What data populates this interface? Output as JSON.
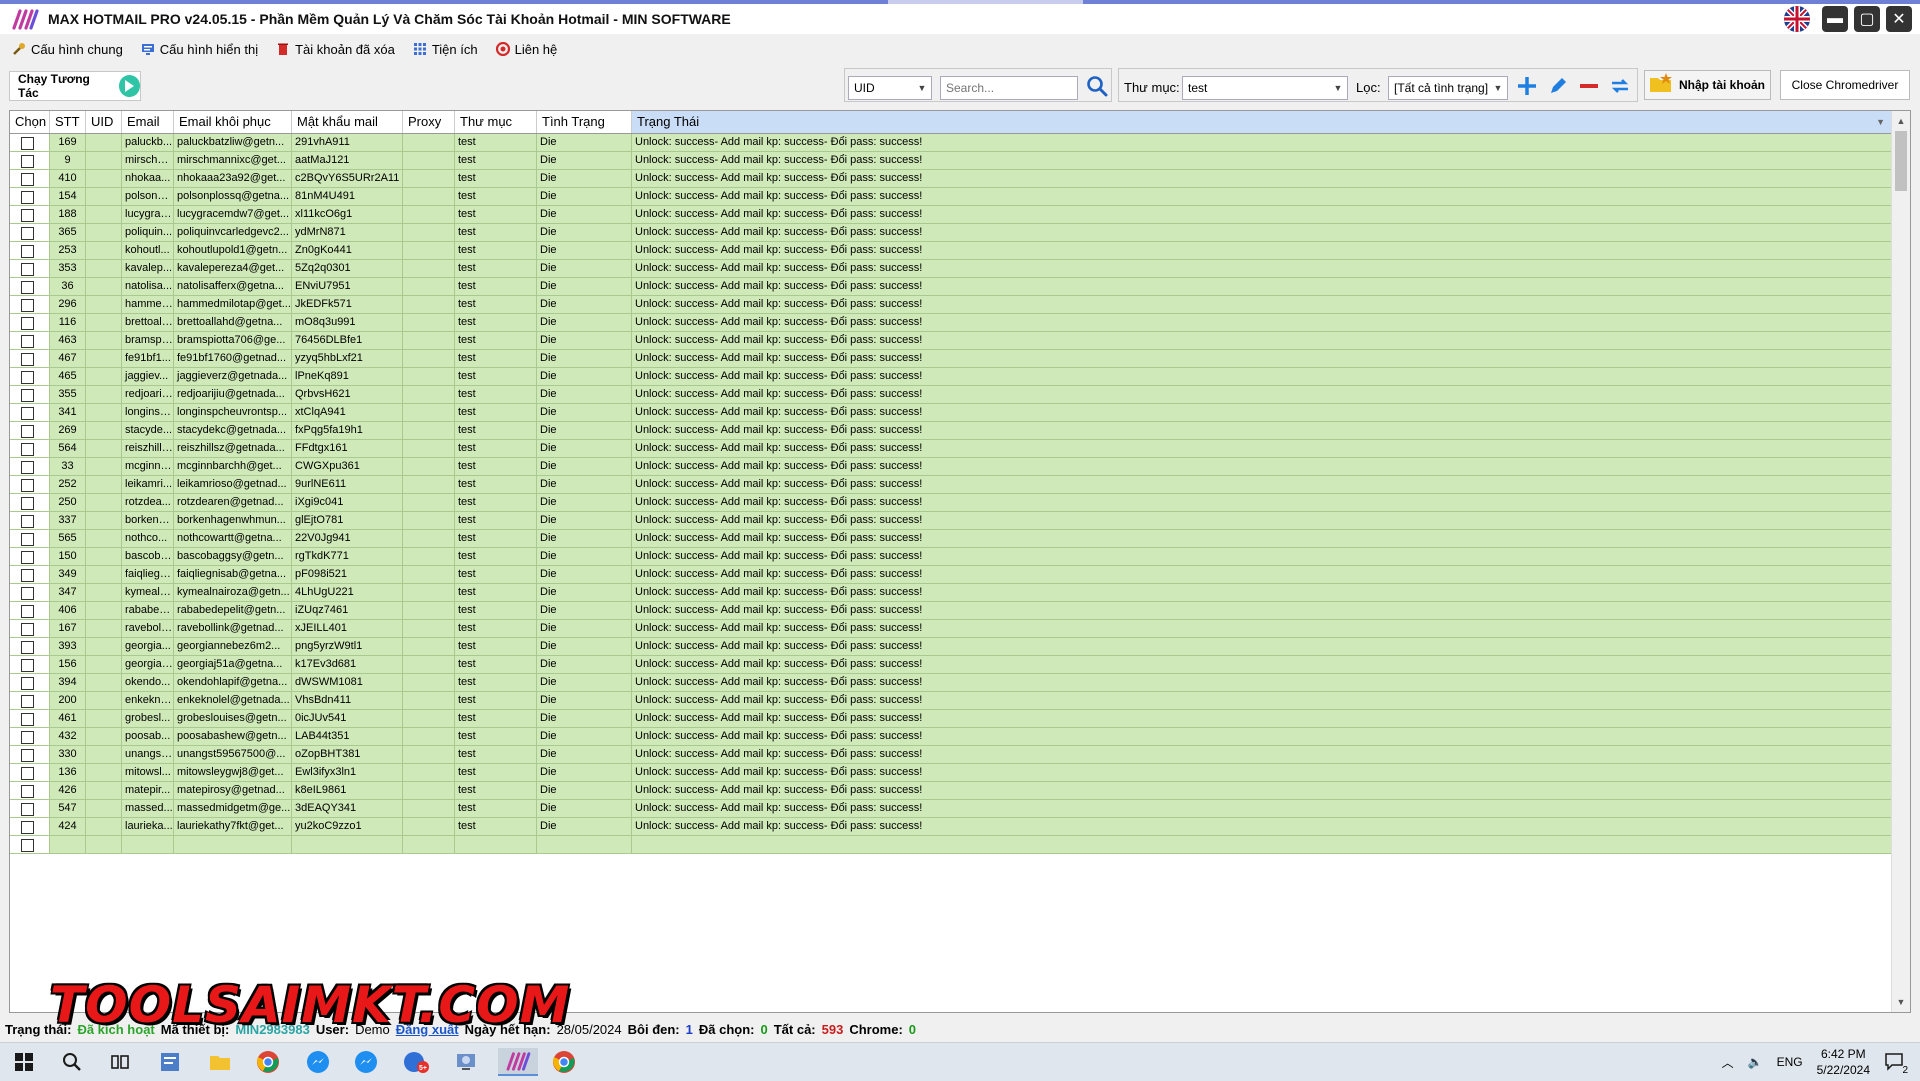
{
  "window": {
    "title": "MAX HOTMAIL PRO v24.05.15 - Phần Mềm Quản Lý Và Chăm Sóc Tài Khoản Hotmail - MIN SOFTWARE",
    "min_glyph": "▬",
    "max_glyph": "▢",
    "close_glyph": "✕"
  },
  "menu": {
    "items": [
      {
        "label": "Cấu hình chung",
        "icon": "wrench-icon",
        "color": "#c08a1e"
      },
      {
        "label": "Cấu hình hiển thị",
        "icon": "display-settings-icon",
        "color": "#3b6fd4"
      },
      {
        "label": "Tài khoản đã xóa",
        "icon": "trash-icon",
        "color": "#d42a2a"
      },
      {
        "label": "Tiện ích",
        "icon": "grid-apps-icon",
        "color": "#3b6fd4"
      },
      {
        "label": "Liên hệ",
        "icon": "contact-icon",
        "color": "#d42a2a"
      }
    ]
  },
  "toolbar": {
    "run_label": "Chạy Tương Tác",
    "search_field": "UID",
    "search_placeholder": "Search...",
    "folder_label": "Thư mục:",
    "folder_value": "test",
    "filter_label": "Lọc:",
    "filter_value": "[Tất cả tình trạng]",
    "import_label": "Nhập tài khoản",
    "close_chrome_label": "Close Chromedriver"
  },
  "grid": {
    "columns": [
      "Chọn",
      "STT",
      "UID",
      "Email",
      "Email khôi phục",
      "Mật khẩu mail",
      "Proxy",
      "Thư mục",
      "Tình Trạng",
      "Trạng Thái"
    ],
    "status_text": "Unlock: success- Add mail kp: success- Đổi pass: success!",
    "folder": "test",
    "state": "Die",
    "rows": [
      [
        "169",
        "paluckb...",
        "paluckbatzliw@getn...",
        "291vhA911"
      ],
      [
        "9",
        "mirschm...",
        "mirschmannixc@get...",
        "aatMaJ121"
      ],
      [
        "410",
        "nhokaa...",
        "nhokaaa23a92@get...",
        "c2BQvY6S5URr2A11"
      ],
      [
        "154",
        "polsonpl...",
        "polsonplossq@getna...",
        "81nM4U491"
      ],
      [
        "188",
        "lucygrac...",
        "lucygracemdw7@get...",
        "xl11kcO6g1"
      ],
      [
        "365",
        "poliquin...",
        "poliquinvcarledgevc2...",
        "ydMrN871"
      ],
      [
        "253",
        "kohoutl...",
        "kohoutlupold1@getn...",
        "Zn0gKo441"
      ],
      [
        "353",
        "kavalep...",
        "kavalepereza4@get...",
        "5Zq2q0301"
      ],
      [
        "36",
        "natolisa...",
        "natolisafferx@getna...",
        "ENviU7951"
      ],
      [
        "296",
        "hammed...",
        "hammedmilotap@get...",
        "JkEDFk571"
      ],
      [
        "116",
        "brettoall...",
        "brettoallahd@getna...",
        "mO8q3u991"
      ],
      [
        "463",
        "bramspi...",
        "bramspiotta706@ge...",
        "76456DLBfe1"
      ],
      [
        "467",
        "fe91bf1...",
        "fe91bf1760@getnad...",
        "yzyq5hbLxf21"
      ],
      [
        "465",
        "jaggiev...",
        "jaggieverz@getnada...",
        "lPneKq891"
      ],
      [
        "355",
        "redjoarij...",
        "redjoarijiu@getnada...",
        "QrbvsH621"
      ],
      [
        "341",
        "longinsp...",
        "longinspcheuvrontsp...",
        "xtClqA941"
      ],
      [
        "269",
        "stacyde...",
        "stacydekc@getnada...",
        "fxPqg5fa19h1"
      ],
      [
        "564",
        "reiszhills...",
        "reiszhillsz@getnada...",
        "FFdtgx161"
      ],
      [
        "33",
        "mcginnb...",
        "mcginnbarchh@get...",
        "CWGXpu361"
      ],
      [
        "252",
        "leikamri...",
        "leikamrioso@getnad...",
        "9urlNE611"
      ],
      [
        "250",
        "rotzdea...",
        "rotzdearen@getnad...",
        "iXgi9c041"
      ],
      [
        "337",
        "borkenh...",
        "borkenhagenwhmun...",
        "glEjtO781"
      ],
      [
        "565",
        "nothco...",
        "nothcowartt@getna...",
        "22V0Jg941"
      ],
      [
        "150",
        "bascoba...",
        "bascobaggsy@getn...",
        "rgTkdK771"
      ],
      [
        "349",
        "faiqliegn...",
        "faiqliegnisab@getna...",
        "pF098i521"
      ],
      [
        "347",
        "kymealn...",
        "kymealnairoza@getn...",
        "4LhUgU221"
      ],
      [
        "406",
        "rababed...",
        "rababedepelit@getn...",
        "iZUqz7461"
      ],
      [
        "167",
        "ravebolli...",
        "ravebollink@getnad...",
        "xJEILL401"
      ],
      [
        "393",
        "georgia...",
        "georgiannebez6m2...",
        "png5yrzW9tl1"
      ],
      [
        "156",
        "georgiaj...",
        "georgiaj51a@getna...",
        "k17Ev3d681"
      ],
      [
        "394",
        "okendo...",
        "okendohlapif@getna...",
        "dWSWM1081"
      ],
      [
        "200",
        "enkekno...",
        "enkeknolel@getnada...",
        "VhsBdn411"
      ],
      [
        "461",
        "grobesl...",
        "grobeslouises@getn...",
        "0icJUv541"
      ],
      [
        "432",
        "poosab...",
        "poosabashew@getn...",
        "LAB44t351"
      ],
      [
        "330",
        "unangst...",
        "unangst59567500@...",
        "oZopBHT381"
      ],
      [
        "136",
        "mitowsl...",
        "mitowsleygwj8@get...",
        "Ewl3ifyx3ln1"
      ],
      [
        "426",
        "matepir...",
        "matepirosy@getnad...",
        "k8eIL9861"
      ],
      [
        "547",
        "massed...",
        "massedmidgetm@ge...",
        "3dEAQY341"
      ],
      [
        "424",
        "laurieka...",
        "lauriekathy7fkt@get...",
        "yu2koC9zzo1"
      ],
      [
        "",
        "",
        "",
        ""
      ]
    ]
  },
  "status": {
    "label_status": "Trạng thái:",
    "status_value": "Đã kích hoạt",
    "label_device": "Mã thiết bị:",
    "device_value": "MIN2983983",
    "label_user": "User:",
    "user_value": "Demo",
    "logout": "Đăng xuất",
    "label_expiry": "Ngày hết hạn:",
    "expiry_value": "28/05/2024",
    "label_highlight": "Bôi đen:",
    "highlight_value": "1",
    "label_selected": "Đã chọn:",
    "selected_value": "0",
    "label_total": "Tất cả:",
    "total_value": "593",
    "label_chrome": "Chrome:",
    "chrome_value": "0"
  },
  "watermark": "TOOLSAIMKT.COM",
  "taskbar": {
    "lang": "ENG",
    "time": "6:42 PM",
    "date": "5/22/2024",
    "notif_count": "2",
    "badge": "5+"
  },
  "colors": {
    "row_bg": "#cfe9b8",
    "selected_header": "#c9ddf7",
    "accent_play": "#2ec4a5"
  }
}
